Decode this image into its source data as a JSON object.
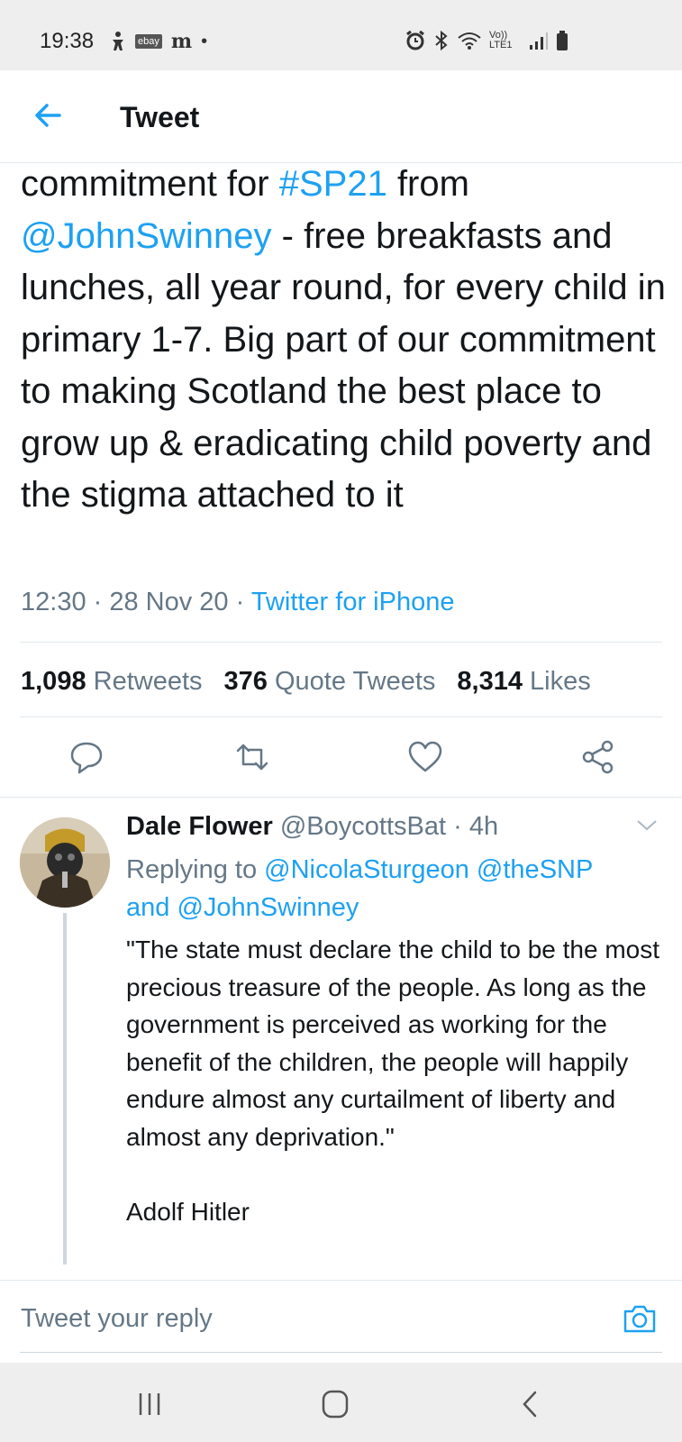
{
  "status_bar": {
    "time": "19:38",
    "ebay": "ebay",
    "m": "m",
    "dot": "•",
    "network": "Vo)) LTE1"
  },
  "app_bar": {
    "title": "Tweet",
    "back_icon": "arrow-left-icon"
  },
  "tweet": {
    "part1": "commitment for ",
    "hashtag": "#SP21",
    "part2": " from",
    "mention": "@JohnSwinney",
    "part3": " - free breakfasts and lunches, all year round, for every child in primary 1-7. Big part of our commitment to making Scotland the best place to grow up & eradicating child poverty and the stigma attached to it",
    "time": "12:30",
    "sep1": " · ",
    "date": "28 Nov 20",
    "sep2": " · ",
    "source": "Twitter for iPhone",
    "retweets_count": "1,098",
    "retweets_label": "Retweets",
    "quotes_count": "376",
    "quotes_label": "Quote Tweets",
    "likes_count": "8,314",
    "likes_label": "Likes"
  },
  "actions": [
    "reply-icon",
    "retweet-icon",
    "like-icon",
    "share-icon"
  ],
  "reply": {
    "name": "Dale Flower",
    "handle": "@BoycottsBat",
    "sep": " · ",
    "time": "4h",
    "replying_prefix": "Replying to ",
    "replying_mentions": "@NicolaSturgeon @theSNP",
    "replying_and": "and ",
    "replying_last": "@JohnSwinney",
    "text": "\"The state must declare the child to be the most precious treasure of the people. As long as the government is perceived as working for the benefit of the children, the people will happily endure almost any curtailment of liberty and almost any deprivation.\"\n\nAdolf Hitler"
  },
  "composer": {
    "placeholder": "Tweet your reply"
  },
  "colors": {
    "accent": "#1da1f2",
    "secondary_text": "#657786",
    "primary_text": "#14171a"
  }
}
